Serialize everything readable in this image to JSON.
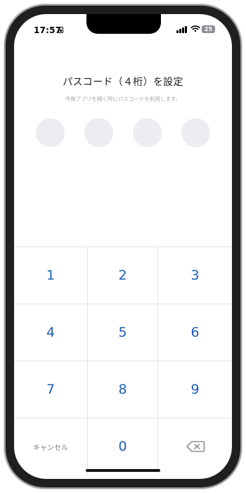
{
  "status_bar": {
    "time": "17:57",
    "battery": "25"
  },
  "header": {
    "title": "パスコード（４桁）を設定",
    "subtitle": "今後アプリを開く時にパスコードを利用します。"
  },
  "passcode": {
    "length": 4,
    "entered": 0
  },
  "keypad": {
    "keys": [
      "1",
      "2",
      "3",
      "4",
      "5",
      "6",
      "7",
      "8",
      "9"
    ],
    "zero": "0",
    "cancel": "キャンセル",
    "delete_icon": "backspace-icon"
  },
  "colors": {
    "accent": "#1d5fb4",
    "dot_empty": "#ececf1",
    "muted": "#7b7b82"
  }
}
